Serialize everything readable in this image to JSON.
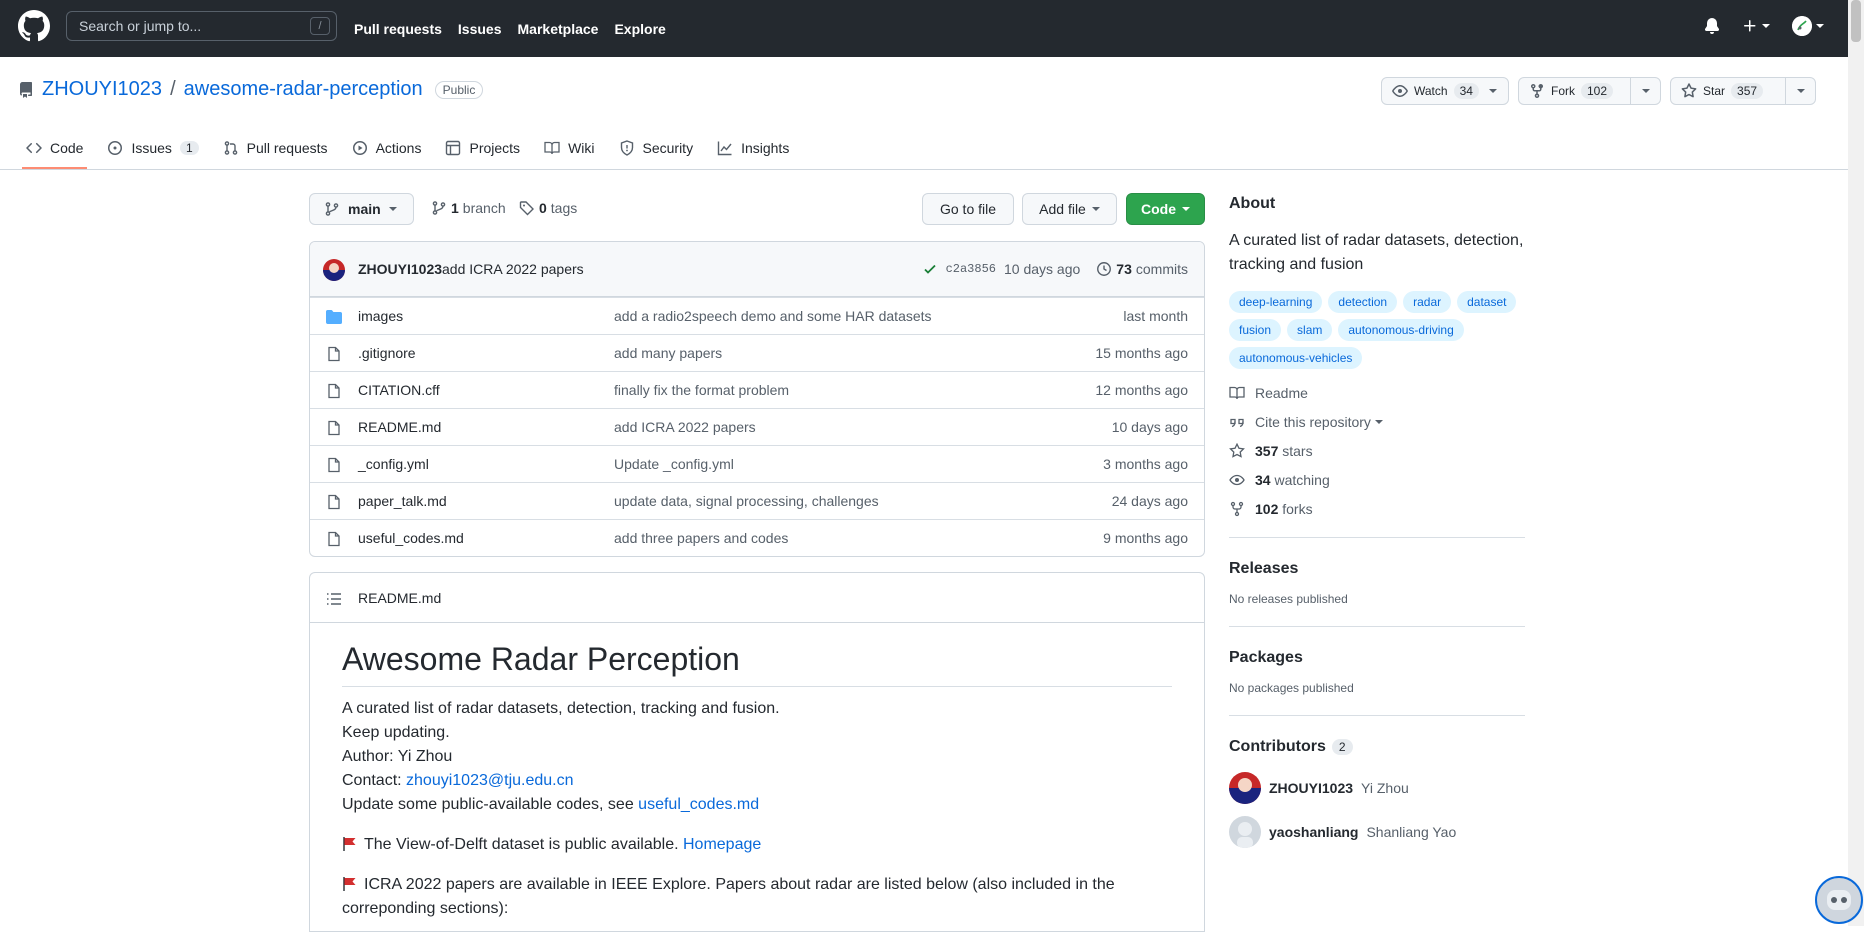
{
  "topnav": {
    "search_placeholder": "Search or jump to...",
    "slash_key": "/",
    "links": [
      "Pull requests",
      "Issues",
      "Marketplace",
      "Explore"
    ]
  },
  "repo": {
    "owner": "ZHOUYI1023",
    "separator": "/",
    "name": "awesome-radar-perception",
    "visibility": "Public",
    "watch_label": "Watch",
    "watch_count": "34",
    "fork_label": "Fork",
    "fork_count": "102",
    "star_label": "Star",
    "star_count": "357"
  },
  "tabs": [
    {
      "label": "Code",
      "icon": "code-icon"
    },
    {
      "label": "Issues",
      "icon": "issue-icon",
      "count": "1"
    },
    {
      "label": "Pull requests",
      "icon": "pull-request-icon"
    },
    {
      "label": "Actions",
      "icon": "actions-icon"
    },
    {
      "label": "Projects",
      "icon": "projects-icon"
    },
    {
      "label": "Wiki",
      "icon": "book-icon"
    },
    {
      "label": "Security",
      "icon": "shield-icon"
    },
    {
      "label": "Insights",
      "icon": "graph-icon"
    }
  ],
  "filebar": {
    "branch": "main",
    "branches_count": "1",
    "branches_label": "branch",
    "tags_count": "0",
    "tags_label": "tags",
    "goto_file": "Go to file",
    "add_file": "Add file",
    "code": "Code"
  },
  "commit": {
    "author": "ZHOUYI1023",
    "message": "add ICRA 2022 papers",
    "sha": "c2a3856",
    "when": "10 days ago",
    "commits_count": "73",
    "commits_label": "commits"
  },
  "files": [
    {
      "name": "images",
      "type": "folder",
      "message": "add a radio2speech demo and some HAR datasets",
      "date": "last month"
    },
    {
      "name": ".gitignore",
      "type": "file",
      "message": "add many papers",
      "date": "15 months ago"
    },
    {
      "name": "CITATION.cff",
      "type": "file",
      "message": "finally fix the format problem",
      "date": "12 months ago"
    },
    {
      "name": "README.md",
      "type": "file",
      "message": "add ICRA 2022 papers",
      "date": "10 days ago"
    },
    {
      "name": "_config.yml",
      "type": "file",
      "message": "Update _config.yml",
      "date": "3 months ago"
    },
    {
      "name": "paper_talk.md",
      "type": "file",
      "message": "update data, signal processing, challenges",
      "date": "24 days ago"
    },
    {
      "name": "useful_codes.md",
      "type": "file",
      "message": "add three papers and codes",
      "date": "9 months ago"
    }
  ],
  "readme": {
    "filename": "README.md",
    "title": "Awesome Radar Perception",
    "line1": "A curated list of radar datasets, detection, tracking and fusion.",
    "line2": "Keep updating.",
    "line3": "Author: Yi Zhou",
    "contact_label": "Contact: ",
    "contact_email": "zhouyi1023@tju.edu.cn",
    "update_label": "Update some public-available codes, see ",
    "update_link": "useful_codes.md",
    "news1": "The View-of-Delft dataset is public available. ",
    "news1_link": "Homepage",
    "news2": "ICRA 2022 papers are available in IEEE Explore. Papers about radar are listed below (also included in the correponding sections):"
  },
  "sidebar": {
    "about_title": "About",
    "about_text": "A curated list of radar datasets, detection, tracking and fusion",
    "topics": [
      "deep-learning",
      "detection",
      "radar",
      "dataset",
      "fusion",
      "slam",
      "autonomous-driving",
      "autonomous-vehicles"
    ],
    "readme": "Readme",
    "cite": "Cite this repository",
    "stars_count": "357",
    "stars_label": "stars",
    "watching_count": "34",
    "watching_label": "watching",
    "forks_count": "102",
    "forks_label": "forks",
    "releases_title": "Releases",
    "releases_empty": "No releases published",
    "packages_title": "Packages",
    "packages_empty": "No packages published",
    "contributors_title": "Contributors",
    "contributors_count": "2",
    "contributors": [
      {
        "login": "ZHOUYI1023",
        "name": "Yi Zhou"
      },
      {
        "login": "yaoshanliang",
        "name": "Shanliang Yao"
      }
    ]
  },
  "colors": {
    "header_bg": "#24292f",
    "link": "#0969da",
    "primary_button": "#2da44e",
    "tab_underline": "#fd8c73",
    "topic_bg": "#ddf4ff"
  }
}
